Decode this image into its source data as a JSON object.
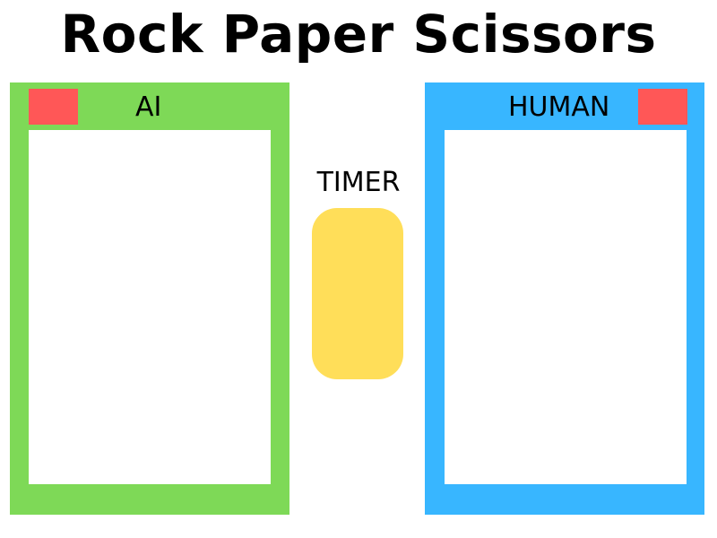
{
  "title": "Rock Paper Scissors",
  "ai_panel": {
    "label": "AI",
    "color": "#7ED957",
    "score_color": "#FF5757"
  },
  "human_panel": {
    "label": "HUMAN",
    "color": "#38B6FF",
    "score_color": "#FF5757"
  },
  "timer": {
    "label": "TIMER",
    "color": "#FFDE59"
  }
}
